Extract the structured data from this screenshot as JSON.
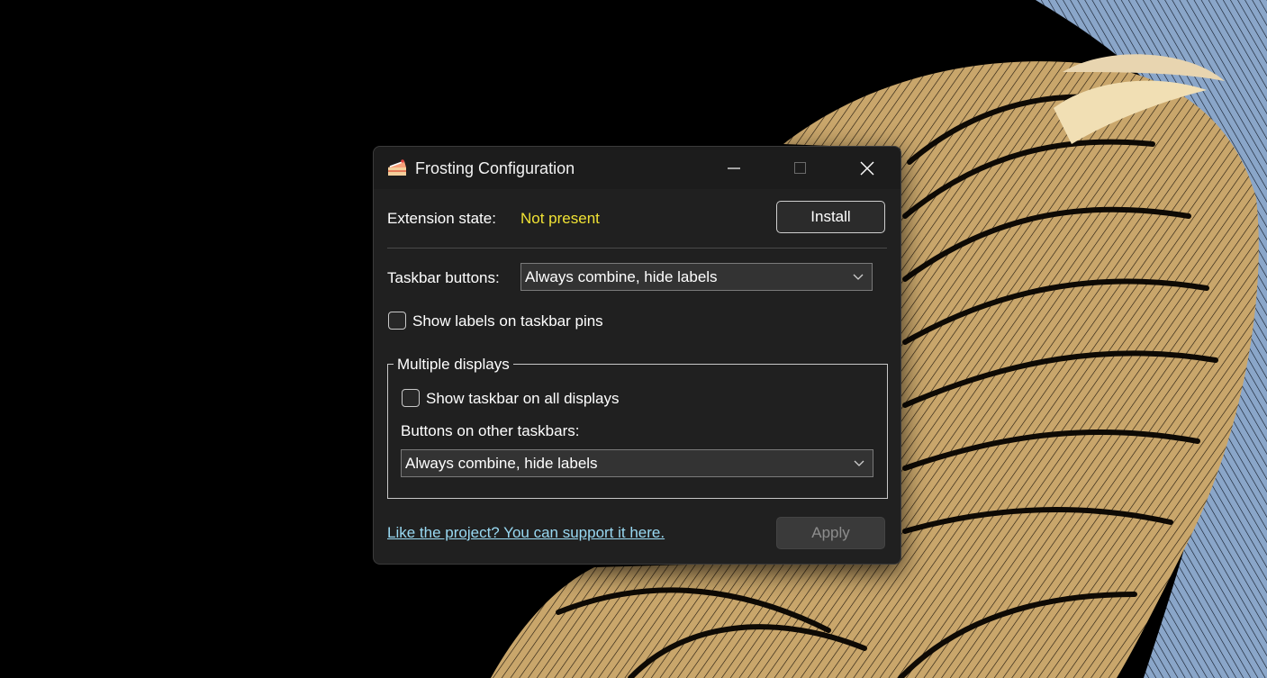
{
  "window": {
    "title": "Frosting Configuration",
    "icon": "cake-slice-icon"
  },
  "extension": {
    "state_label": "Extension state:",
    "state_value": "Not present",
    "state_color": "#f0e234",
    "install_label": "Install"
  },
  "taskbar": {
    "buttons_label": "Taskbar buttons:",
    "buttons_value": "Always combine, hide labels",
    "show_labels_on_pins": "Show labels on taskbar pins",
    "show_labels_on_pins_checked": false
  },
  "multiple_displays": {
    "legend": "Multiple displays",
    "show_on_all": "Show taskbar on all displays",
    "show_on_all_checked": false,
    "other_buttons_label": "Buttons on other taskbars:",
    "other_buttons_value": "Always combine, hide labels"
  },
  "footer": {
    "support_link": "Like the project? You can support it here.",
    "apply_label": "Apply"
  },
  "colors": {
    "window_bg": "#202020",
    "link": "#99d9f2",
    "wallpaper_tan": "#c9a66b",
    "wallpaper_blue": "#7f9bbf"
  }
}
